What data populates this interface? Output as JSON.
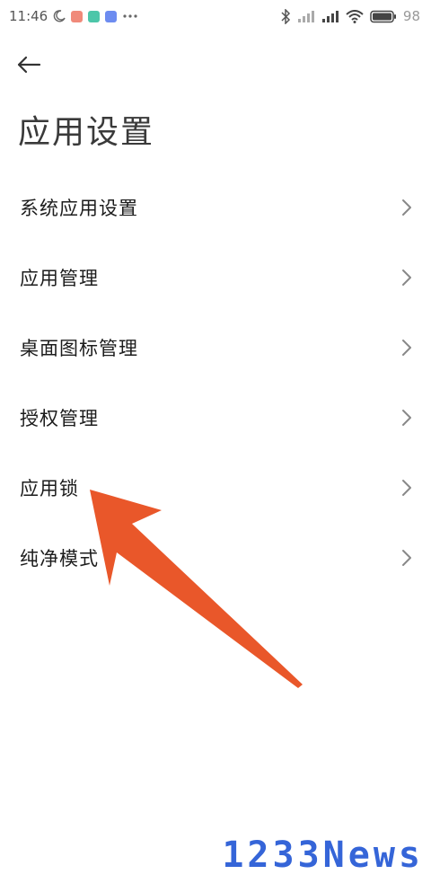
{
  "status_bar": {
    "time": "11:46",
    "battery": "98"
  },
  "page": {
    "title": "应用设置"
  },
  "menu": {
    "items": [
      {
        "label": "系统应用设置"
      },
      {
        "label": "应用管理"
      },
      {
        "label": "桌面图标管理"
      },
      {
        "label": "授权管理"
      },
      {
        "label": "应用锁"
      },
      {
        "label": "纯净模式"
      }
    ]
  },
  "annotation": {
    "color": "#e9572a"
  },
  "watermark": {
    "text": "1233News"
  }
}
